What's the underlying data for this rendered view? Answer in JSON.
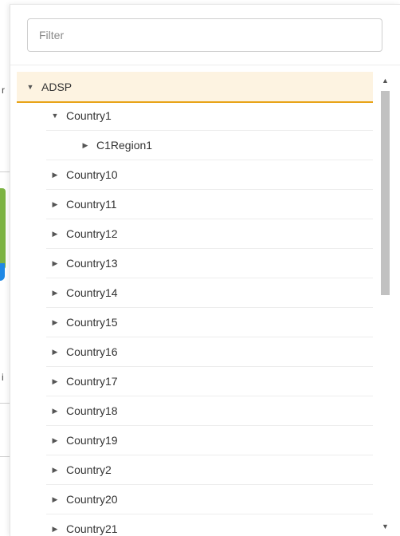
{
  "filter": {
    "placeholder": "Filter",
    "value": ""
  },
  "tree": {
    "root": {
      "label": "ADSP",
      "expanded": true
    },
    "country1": {
      "label": "Country1",
      "expanded": true
    },
    "region": {
      "label": "C1Region1"
    },
    "countries": [
      "Country10",
      "Country11",
      "Country12",
      "Country13",
      "Country14",
      "Country15",
      "Country16",
      "Country17",
      "Country18",
      "Country19",
      "Country2",
      "Country20",
      "Country21"
    ]
  },
  "icons": {
    "expanded": "caret-down-icon",
    "collapsed": "caret-right-icon",
    "scroll_up": "scroll-up-arrow-icon",
    "scroll_down": "scroll-down-arrow-icon"
  },
  "colors": {
    "selected_bg": "#fdf3e1",
    "selected_border": "#e8a317",
    "scroll_thumb": "#c1c1c1"
  }
}
